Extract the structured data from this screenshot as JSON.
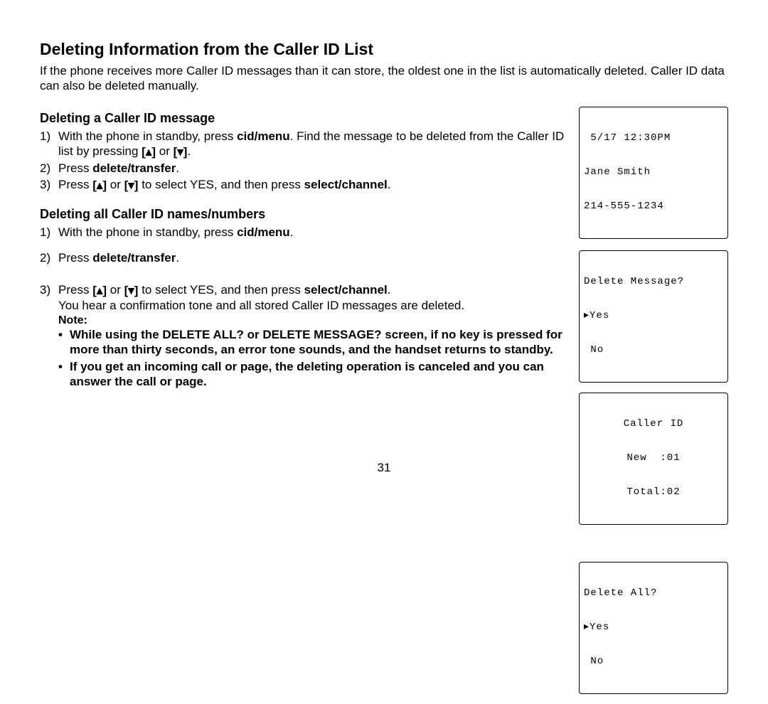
{
  "title": "Deleting Information from the Caller ID List",
  "intro": "If the phone receives more Caller ID messages than it can store, the oldest one in the list is automatically deleted. Caller ID data can also be deleted manually.",
  "section1": {
    "heading": "Deleting a Caller ID message",
    "steps": {
      "s1a": "With the phone in standby, press ",
      "s1b": "cid/menu",
      "s1c": ". Find the message to be deleted from the Caller ID list by pressing ",
      "s1d": " or ",
      "s1e": ".",
      "s2a": "Press ",
      "s2b": "delete/transfer",
      "s2c": ".",
      "s3a": "Press ",
      "s3b": " or ",
      "s3c": " to select YES, and then press ",
      "s3d": "select/channel",
      "s3e": "."
    }
  },
  "section2": {
    "heading": "Deleting all Caller ID names/numbers",
    "steps": {
      "s1a": "With the phone in standby, press ",
      "s1b": "cid/menu",
      "s1c": ".",
      "s2a": "Press ",
      "s2b": "delete/transfer",
      "s2c": ".",
      "s3a": "Press ",
      "s3b": " or ",
      "s3c": " to select YES, and then press ",
      "s3d": "select/channel",
      "s3e": ".",
      "s3f": "You hear a confirmation tone and all stored Caller ID messages are deleted."
    }
  },
  "note_label": "Note:",
  "notes": {
    "n1": "While using the DELETE ALL? or DELETE MESSAGE? screen, if no key is pressed for more than thirty seconds, an error tone sounds, and the handset returns to standby.",
    "n2": "If you get an incoming call or page, the deleting operation is canceled and you can answer the call or page."
  },
  "screens": {
    "a1": " 5/17 12:30PM",
    "a2": "Jane Smith",
    "a3": "214-555-1234",
    "b1": "Delete Message?",
    "b2": "▸Yes",
    "b3": " No",
    "c1": "Caller ID",
    "c2": "New  :01",
    "c3": "Total:02",
    "d1": "Delete All?",
    "d2": "▸Yes",
    "d3": " No"
  },
  "nums": {
    "n1": "1)",
    "n2": "2)",
    "n3": "3)"
  },
  "bullet": "•",
  "key_up": "[▴]",
  "key_down": "[▾]",
  "page_number": "31"
}
